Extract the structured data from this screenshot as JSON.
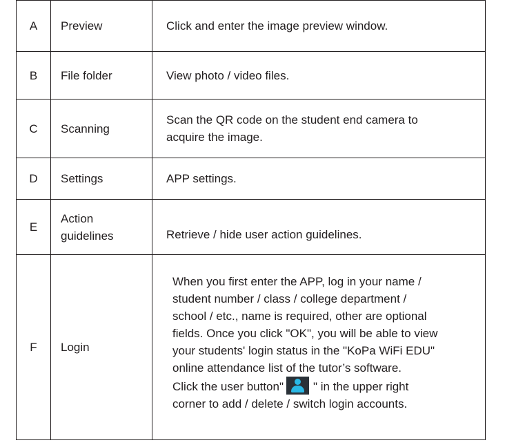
{
  "rows": [
    {
      "key": "A",
      "name": "Preview",
      "desc": "Click and enter the image preview window."
    },
    {
      "key": "B",
      "name": "File folder",
      "desc": "View photo / video files."
    },
    {
      "key": "C",
      "name": "Scanning",
      "desc_lines": [
        "Scan the QR code on the student end camera to",
        "acquire the image."
      ]
    },
    {
      "key": "D",
      "name": "Settings",
      "desc": "APP settings."
    },
    {
      "key": "E",
      "name_lines": [
        "Action",
        "guidelines"
      ],
      "desc": "Retrieve / hide user action guidelines."
    },
    {
      "key": "F",
      "name": "Login",
      "desc_lines": [
        "When you first enter the APP, log in your name /",
        "student number / class / college department /",
        "school / etc., name is required, other are optional",
        "fields. Once you click \"OK\", you will be able to view",
        "your students' login status in the \"KoPa WiFi EDU\"",
        "online attendance list of the tutor’s software."
      ],
      "button_line_before": "Click the user button\"",
      "button_icon": "user-icon",
      "button_line_after": "\" in the upper right",
      "last_line": "corner to add / delete / switch login accounts."
    }
  ]
}
